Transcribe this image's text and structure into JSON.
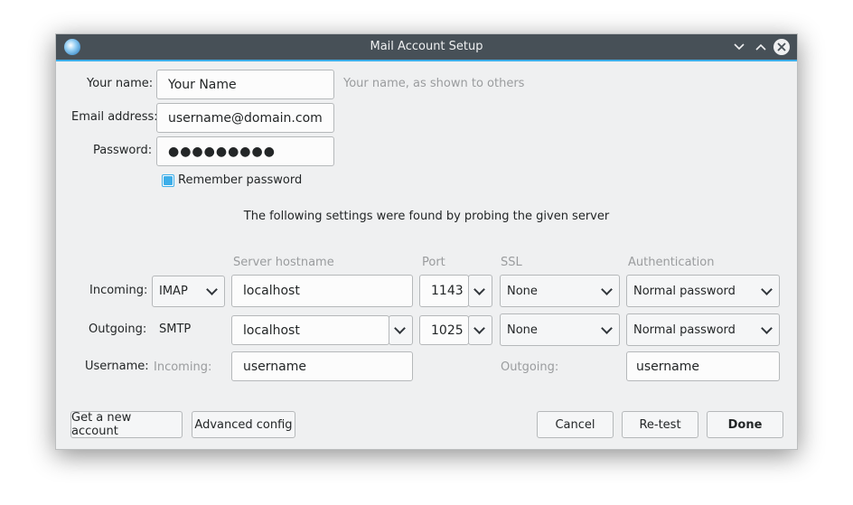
{
  "window": {
    "title": "Mail Account Setup",
    "controls": [
      "minimize",
      "maximize",
      "close"
    ]
  },
  "identity": {
    "name_label": "Your name:",
    "name_value": "Your Name",
    "name_hint": "Your name, as shown to others",
    "email_label": "Email address:",
    "email_value": "username@domain.com",
    "password_label": "Password:",
    "password_value": "●●●●●●●●●",
    "remember_label": "Remember password",
    "remember_checked": true
  },
  "probe_message": "The following settings were found by probing the given server",
  "columns": {
    "hostname": "Server hostname",
    "port": "Port",
    "ssl": "SSL",
    "auth": "Authentication"
  },
  "incoming": {
    "label": "Incoming:",
    "protocol": "IMAP",
    "hostname": "localhost",
    "port": "1143",
    "ssl": "None",
    "auth": "Normal password"
  },
  "outgoing": {
    "label": "Outgoing:",
    "protocol": "SMTP",
    "hostname": "localhost",
    "port": "1025",
    "ssl": "None",
    "auth": "Normal password"
  },
  "username": {
    "label": "Username:",
    "incoming_label": "Incoming:",
    "incoming_value": "username",
    "outgoing_label": "Outgoing:",
    "outgoing_value": "username"
  },
  "buttons": {
    "get_account": "Get a new account",
    "advanced": "Advanced config",
    "cancel": "Cancel",
    "retest": "Re-test",
    "done": "Done"
  },
  "colors": {
    "accent": "#3daee9",
    "titlebar": "#475057",
    "window_bg": "#eff0f1"
  }
}
